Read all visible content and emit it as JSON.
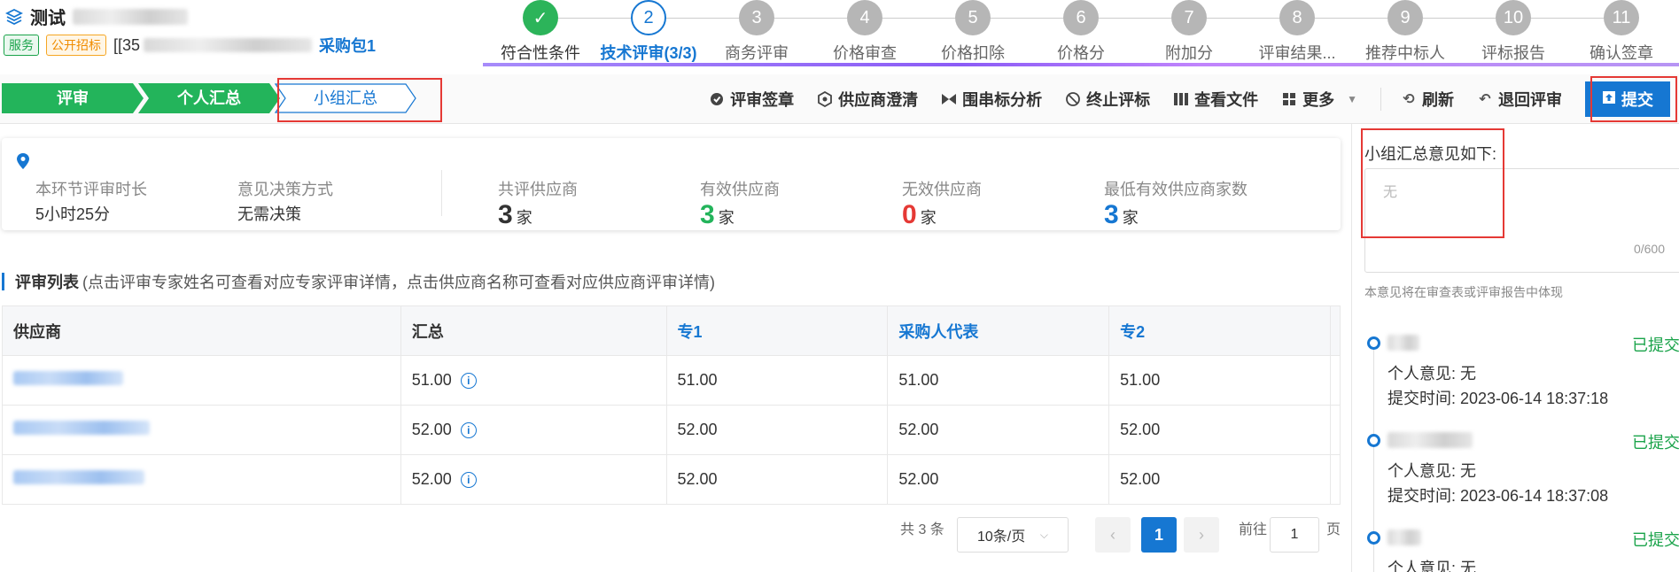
{
  "header": {
    "title": "测试",
    "tags": [
      "服务",
      "公开招标"
    ],
    "project_code": "[[35",
    "package": "采购包1"
  },
  "steps": [
    {
      "num": "✓",
      "label": "符合性条件",
      "state": "done"
    },
    {
      "num": "2",
      "label": "技术评审(3/3)",
      "state": "active"
    },
    {
      "num": "3",
      "label": "商务评审",
      "state": "todo"
    },
    {
      "num": "4",
      "label": "价格审查",
      "state": "todo"
    },
    {
      "num": "5",
      "label": "价格扣除",
      "state": "todo"
    },
    {
      "num": "6",
      "label": "价格分",
      "state": "todo"
    },
    {
      "num": "7",
      "label": "附加分",
      "state": "todo"
    },
    {
      "num": "8",
      "label": "评审结果...",
      "state": "todo"
    },
    {
      "num": "9",
      "label": "推荐中标人",
      "state": "todo"
    },
    {
      "num": "10",
      "label": "评标报告",
      "state": "todo"
    },
    {
      "num": "11",
      "label": "确认签章",
      "state": "todo"
    }
  ],
  "breadcrumbs": [
    "评审",
    "个人汇总",
    "小组汇总"
  ],
  "toolbar": {
    "actions": [
      "评审签章",
      "供应商澄清",
      "围串标分析",
      "终止评标",
      "查看文件",
      "更多",
      "刷新",
      "退回评审"
    ],
    "submit": "提交"
  },
  "summary": {
    "duration_label": "本环节评审时长",
    "duration_value": "5小时25分",
    "decision_label": "意见决策方式",
    "decision_value": "无需决策",
    "total_label": "共评供应商",
    "total_value": "3",
    "valid_label": "有效供应商",
    "valid_value": "3",
    "invalid_label": "无效供应商",
    "invalid_value": "0",
    "min_label": "最低有效供应商家数",
    "min_value": "3",
    "unit": "家"
  },
  "review_list": {
    "title": "评审列表",
    "hint": "(点击评审专家姓名可查看对应专家评审详情，点击供应商名称可查看对应供应商评审详情)",
    "columns": [
      "供应商",
      "汇总",
      "专1",
      "采购人代表",
      "专2"
    ],
    "rows": [
      {
        "summary": "51.00",
        "e1": "51.00",
        "rep": "51.00",
        "e2": "51.00"
      },
      {
        "summary": "52.00",
        "e1": "52.00",
        "rep": "52.00",
        "e2": "52.00"
      },
      {
        "summary": "52.00",
        "e1": "52.00",
        "rep": "52.00",
        "e2": "52.00"
      }
    ]
  },
  "pagination": {
    "total": "共 3 条",
    "page_size": "10条/页",
    "current": "1",
    "goto_label": "前往",
    "goto_value": "1",
    "page_suffix": "页"
  },
  "right_panel": {
    "title": "小组汇总意见如下:",
    "placeholder": "无",
    "count": "0/600",
    "note": "本意见将在审查表或评审报告中体现",
    "entries": [
      {
        "status": "已提交",
        "opinion": "个人意见:  无",
        "time": "提交时间:  2023-06-14 18:37:18"
      },
      {
        "status": "已提交",
        "opinion": "个人意见:  无",
        "time": "提交时间:  2023-06-14 18:37:08"
      },
      {
        "status": "已提交",
        "opinion": "个人意见:  无",
        "time": ""
      }
    ]
  },
  "colors": {
    "primary": "#1677d2",
    "success": "#23b45b",
    "danger": "#e53935"
  }
}
